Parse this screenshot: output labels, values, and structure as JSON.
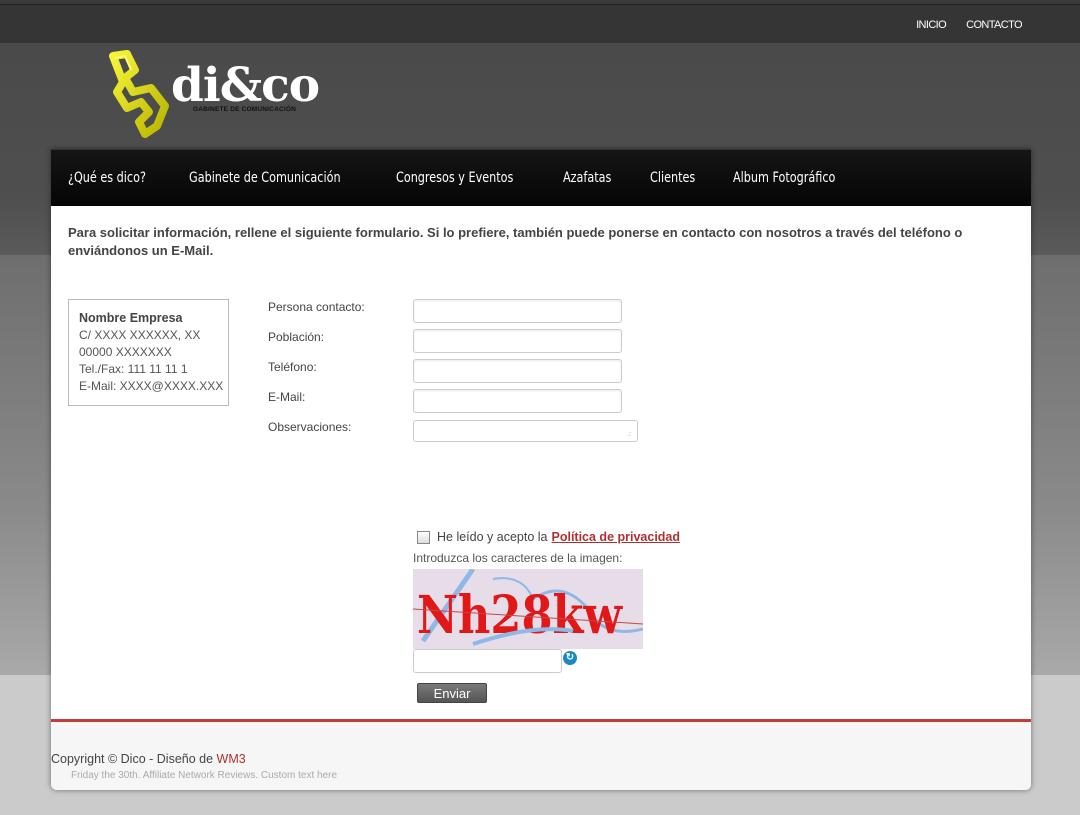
{
  "top_nav": {
    "inicio": "INICIO",
    "contacto": "CONTACTO"
  },
  "logo": {
    "text": "di&co",
    "subtitle": "GABINETE DE COMUNICACIÓN"
  },
  "main_nav": [
    "¿Qué es dico?",
    "Gabinete de Comunicación",
    "Congresos y Eventos",
    "Azafatas",
    "Clientes",
    "Album Fotográfico"
  ],
  "intro": "Para solicitar información, rellene el siguiente formulario. Si lo prefiere, también puede ponerse en contacto con nosotros  a través del teléfono o enviándonos un E-Mail.",
  "address": {
    "name": "Nombre Empresa",
    "street": "C/ XXXX XXXXXX, XX",
    "city": "00000 XXXXXXX",
    "phone": "Tel./Fax: 111 11 11 1",
    "email": "E-Mail: XXXX@XXXX.XXX"
  },
  "form": {
    "persona_label": "Persona contacto:",
    "poblacion_label": "Población:",
    "telefono_label": "Teléfono:",
    "email_label": "E-Mail:",
    "observaciones_label": "Observaciones:",
    "privacy_prefix": "He leído y acepto la",
    "privacy_link": "Política de privacidad",
    "captcha_label": "Introduzca los caracteres de la imagen:",
    "captcha_text": "Nh28kw",
    "submit": "Enviar"
  },
  "footer": {
    "copyright": "Copyright © Dico - Diseño de",
    "designer": "WM3",
    "custom_text": "Friday the 30th. Affiliate Network Reviews. Custom text here"
  },
  "colors": {
    "accent": "#c33b3b",
    "link": "#b03030",
    "nav_bg": "#0b0b0b"
  }
}
